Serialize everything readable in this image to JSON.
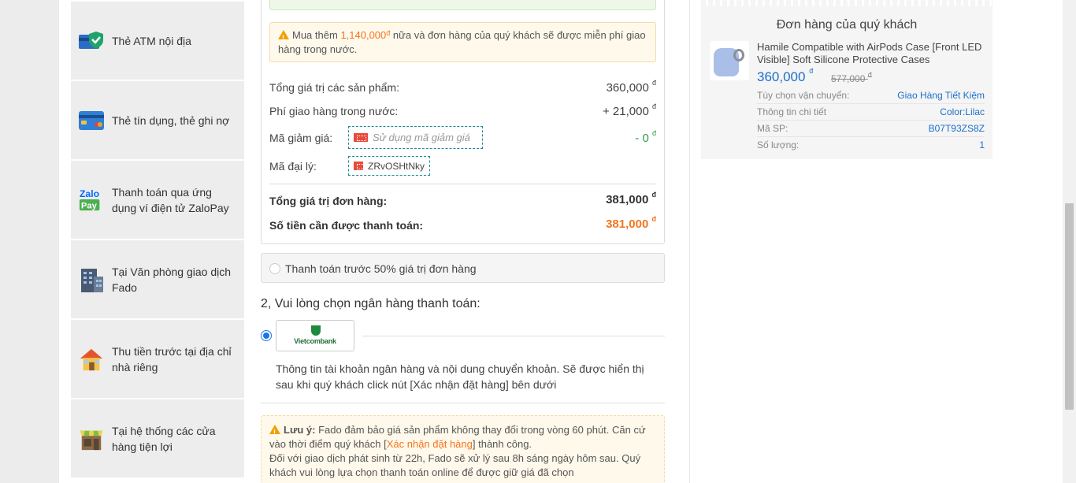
{
  "methods": [
    {
      "icon": "atm-card-shield-icon",
      "label": "Thẻ ATM nội địa"
    },
    {
      "icon": "credit-card-icon",
      "label": "Thẻ tín dụng, thẻ ghi nợ"
    },
    {
      "icon": "zalopay-icon",
      "label": "Thanh toán qua ứng dụng ví điện tử ZaloPay"
    },
    {
      "icon": "office-building-icon",
      "label": "Tại Văn phòng giao dịch Fado"
    },
    {
      "icon": "house-icon",
      "label": "Thu tiền trước tại địa chỉ nhà riêng"
    },
    {
      "icon": "store-icon",
      "label": "Tại hệ thống các cửa hàng tiện lợi"
    }
  ],
  "summary": {
    "free_ship_notice": {
      "prefix": "Mua thêm",
      "amount": "1,140,000",
      "currency": "đ",
      "suffix": "nữa và đơn hàng của quý khách sẽ được miễn phí giao hàng trong nước."
    },
    "subtotal_label": "Tổng giá trị các sản phẩm:",
    "subtotal_value": "360,000",
    "shipping_label": "Phí giao hàng trong nước:",
    "shipping_value": "+ 21,000",
    "discount_label": "Mã giảm giá:",
    "discount_placeholder": "Sử dụng mã giảm giá",
    "discount_value": "- 0",
    "agent_label": "Mã đại lý:",
    "agent_code": "ZRvOSHtNky",
    "order_total_label": "Tổng giá trị đơn hàng:",
    "order_total_value": "381,000",
    "amount_due_label": "Số tiền cần được thanh toán:",
    "amount_due_value": "381,000",
    "currency": "đ"
  },
  "prepay_label": "Thanh toán trước 50% giá trị đơn hàng",
  "bank": {
    "title": "2, Vui lòng chọn ngân hàng thanh toán:",
    "name": "Vietcombank",
    "info": "Thông tin tài khoản ngân hàng và nội dung chuyển khoản. Sẽ được hiển thị sau khi quý khách click nút [Xác nhận đặt hàng] bên dưới"
  },
  "note": {
    "heading": "Lưu ý:",
    "line1_a": "Fado đảm bảo giá sản phẩm không thay đổi trong vòng 60 phút. Căn cứ vào thời điểm quý khách [",
    "line1_link": "Xác nhận đặt hàng",
    "line1_b": "] thành công.",
    "line2": "Đối với giao dịch phát sinh từ 22h, Fado sẽ xử lý sau 8h sáng ngày hôm sau. Quý khách vui lòng lựa chọn thanh toán online để được giữ giá đã chọn"
  },
  "order": {
    "title": "Đơn hàng của quý khách",
    "product_name": "Hamile Compatible with AirPods Case [Front LED Visible] Soft Silicone Protective Cases",
    "price": "360,000",
    "old_price": "577,000",
    "currency": "đ",
    "meta": [
      {
        "label": "Tùy chọn vận chuyển:",
        "value": "Giao Hàng Tiết Kiệm"
      },
      {
        "label": "Thông tin chi tiết",
        "value": "Color:Lilac"
      },
      {
        "label": "Mã SP:",
        "value": "B07T93ZS8Z"
      },
      {
        "label": "Số lượng:",
        "value": "1"
      }
    ]
  },
  "colors": {
    "accent_orange": "#f5751e",
    "link_blue": "#1a6fc9",
    "discount_green": "#2e9e4a"
  }
}
